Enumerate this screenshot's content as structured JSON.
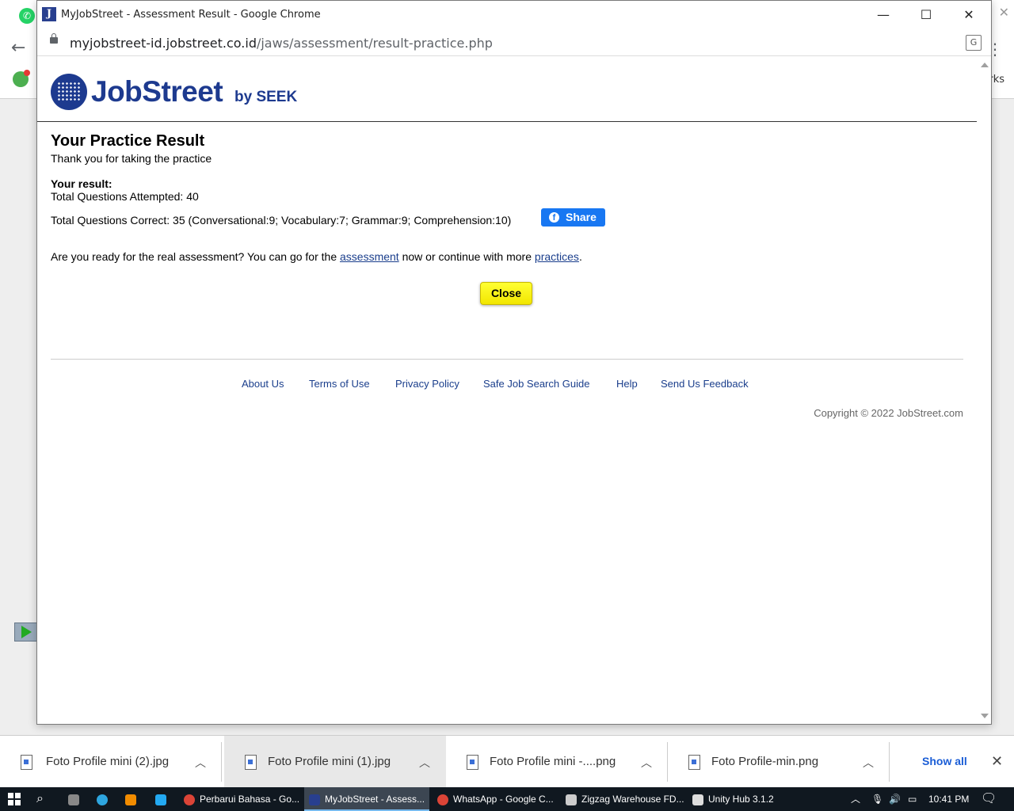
{
  "window": {
    "title": "MyJobStreet - Assessment Result - Google Chrome",
    "favicon_letter": "J",
    "url_host": "myjobstreet-id.jobstreet.co.id",
    "url_path": "/jaws/assessment/result-practice.php",
    "minimize": "—",
    "maximize": "☐",
    "close": "✕"
  },
  "background_browser": {
    "bookmarks_fragment": "rks"
  },
  "logo": {
    "wordmark": "JobStreet",
    "suffix": "by SEEK",
    "brand_color": "#1d3a8f"
  },
  "result": {
    "heading": "Your Practice Result",
    "thanks": "Thank you for taking the practice",
    "label": "Your result:",
    "attempted": "Total Questions Attempted: 40",
    "correct": "Total Questions Correct: 35 (Conversational:9; Vocabulary:7; Grammar:9; Comprehension:10)",
    "share_label": "Share",
    "prompt_before": "Are you ready for the real assessment? You can go for the ",
    "assessment_link": "assessment",
    "prompt_middle": " now or continue with more ",
    "practices_link": "practices",
    "prompt_after": ".",
    "close_label": "Close"
  },
  "footer": {
    "links": [
      "About Us",
      "Terms of Use",
      "Privacy Policy",
      "Safe Job Search Guide",
      "Help",
      "Send Us Feedback"
    ],
    "copyright": "Copyright © 2022 JobStreet.com"
  },
  "downloads": {
    "items": [
      {
        "name": "Foto Profile mini (2).jpg"
      },
      {
        "name": "Foto Profile mini (1).jpg"
      },
      {
        "name": "Foto Profile mini -....png"
      },
      {
        "name": "Foto Profile-min.png"
      }
    ],
    "show_all": "Show all"
  },
  "taskbar": {
    "apps": [
      {
        "label": "Perbarui Bahasa - Go..."
      },
      {
        "label": "MyJobStreet - Assess..."
      },
      {
        "label": "WhatsApp - Google C..."
      },
      {
        "label": "Zigzag Warehouse FD..."
      },
      {
        "label": "Unity Hub 3.1.2"
      }
    ],
    "clock": "10:41 PM"
  },
  "colors": {
    "link": "#1a3e8c",
    "facebook": "#1877f2",
    "close_button": "#ffff33",
    "taskbar": "#101820"
  }
}
